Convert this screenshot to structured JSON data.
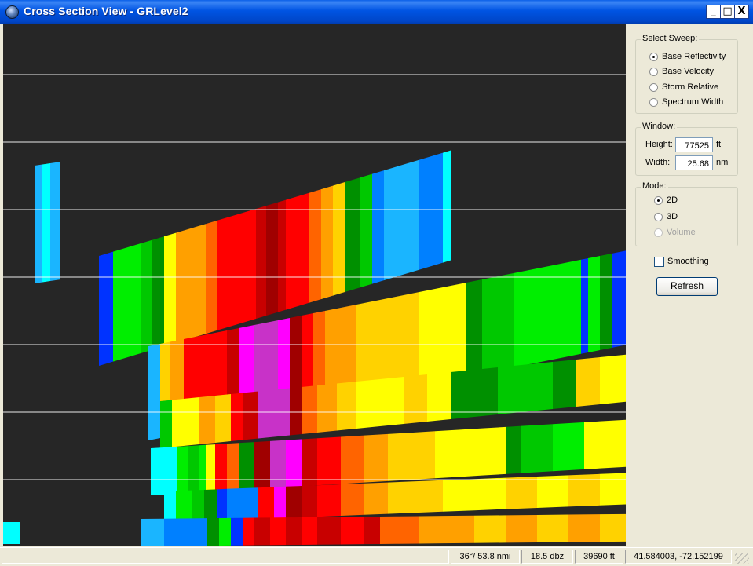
{
  "window": {
    "title": "Cross Section View - GRLevel2",
    "min_glyph": "_",
    "max_glyph": "□",
    "close_glyph": "X"
  },
  "sweep": {
    "title": "Select Sweep:",
    "options": [
      {
        "label": "Base Reflectivity",
        "selected": true,
        "enabled": true
      },
      {
        "label": "Base Velocity",
        "selected": false,
        "enabled": true
      },
      {
        "label": "Storm Relative",
        "selected": false,
        "enabled": true
      },
      {
        "label": "Spectrum Width",
        "selected": false,
        "enabled": true
      }
    ]
  },
  "window_group": {
    "title": "Window:",
    "height_label": "Height:",
    "height_value": "77525",
    "height_unit": "ft",
    "width_label": "Width:",
    "width_value": "25.68",
    "width_unit": "nm"
  },
  "mode": {
    "title": "Mode:",
    "options": [
      {
        "label": "2D",
        "selected": true,
        "enabled": true
      },
      {
        "label": "3D",
        "selected": false,
        "enabled": true
      },
      {
        "label": "Volume",
        "selected": false,
        "enabled": false
      }
    ]
  },
  "smoothing": {
    "label": "Smoothing",
    "checked": false
  },
  "refresh_label": "Refresh",
  "status": {
    "left": "",
    "bearing": "36°/ 53.8 nmi",
    "value": "18.5 dbz",
    "height": "39690 ft",
    "coords": "41.584003, -72.152199"
  },
  "colors": {
    "background": "#262626",
    "gridline": "#FFFFFF",
    "reflectivity_scale": [
      "#00FFFF",
      "#1AB5FF",
      "#0080FF",
      "#0033FF",
      "#00EE00",
      "#00C800",
      "#009000",
      "#FFFF00",
      "#FFD200",
      "#FFA000",
      "#FF6400",
      "#FF0000",
      "#C80000",
      "#A00000",
      "#FF00FF",
      "#C832C8"
    ]
  }
}
